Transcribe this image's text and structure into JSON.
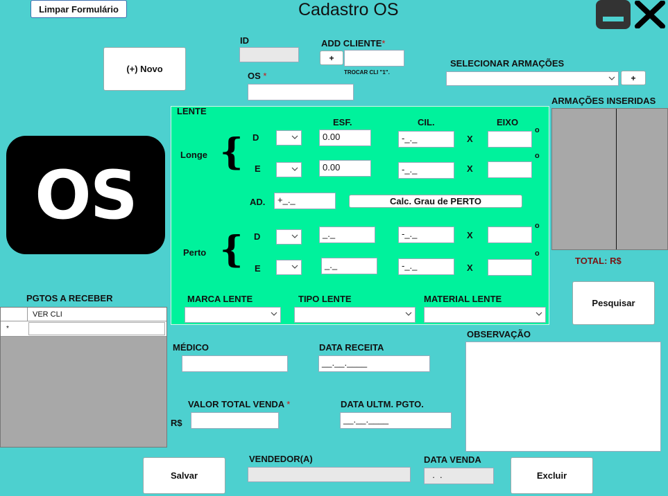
{
  "window": {
    "title": "Cadastro OS",
    "clear_form": "Limpar Formulário",
    "minimize_icon": "minimize-icon",
    "close_icon": "close-icon"
  },
  "left": {
    "new_button": "(+) Novo",
    "logo_text": "OS",
    "payments_title": "PGTOS A RECEBER",
    "payments_column": "VER CLI",
    "payments_new_row_marker": "*"
  },
  "header_fields": {
    "id_label": "ID",
    "id_value": "",
    "os_label": "OS",
    "os_required": "*",
    "os_value": "",
    "add_client_label": "ADD CLIENTE",
    "add_client_required": "*",
    "add_client_button": "+",
    "add_client_value": "",
    "change_client_hint": "TROCAR CLI \"1\".",
    "select_frames_label": "SELECIONAR ARMAÇÕES",
    "select_frames_value": "",
    "add_frame_button": "+"
  },
  "lente": {
    "group_label": "LENTE",
    "col_esf": "ESF.",
    "col_cil": "CIL.",
    "col_eixo": "EIXO",
    "longe_label": "Longe",
    "perto_label": "Perto",
    "d_label": "D",
    "e_label": "E",
    "x_label": "X",
    "deg_symbol": "o",
    "longe_d_esf": "0.00",
    "longe_d_cil": "-_._",
    "longe_d_eixo": "",
    "longe_e_esf": "0.00",
    "longe_e_cil": "-_._",
    "longe_e_eixo": "",
    "ad_label": "AD.",
    "ad_value": "+_._",
    "calc_button": "Calc. Grau de PERTO",
    "perto_d_esf": "_._",
    "perto_d_cil": "-_._",
    "perto_d_eixo": "",
    "perto_e_esf": "_._",
    "perto_e_cil": "-_._",
    "perto_e_eixo": "",
    "marca_label": "MARCA LENTE",
    "tipo_label": "TIPO LENTE",
    "material_label": "MATERIAL LENTE"
  },
  "right": {
    "inserted_frames_title": "ARMAÇÕES INSERIDAS",
    "total_label": "TOTAL: R$",
    "search_button": "Pesquisar",
    "observation_label": "OBSERVAÇÃO",
    "observation_value": ""
  },
  "bottom": {
    "doctor_label": "MÉDICO",
    "doctor_value": "",
    "recipe_date_label": "DATA RECEITA",
    "recipe_date_value": "__.__.____",
    "total_sale_label": "VALOR TOTAL VENDA",
    "total_sale_required": "*",
    "currency_prefix": "R$",
    "total_sale_value": "",
    "last_payment_label": "DATA ULTM. PGTO.",
    "last_payment_value": "__.__.____",
    "save_button": "Salvar",
    "seller_label": "VENDEDOR(A)",
    "seller_value": "",
    "sale_date_label": "DATA VENDA",
    "sale_date_value": "  .  .",
    "delete_button": "Excluir"
  }
}
